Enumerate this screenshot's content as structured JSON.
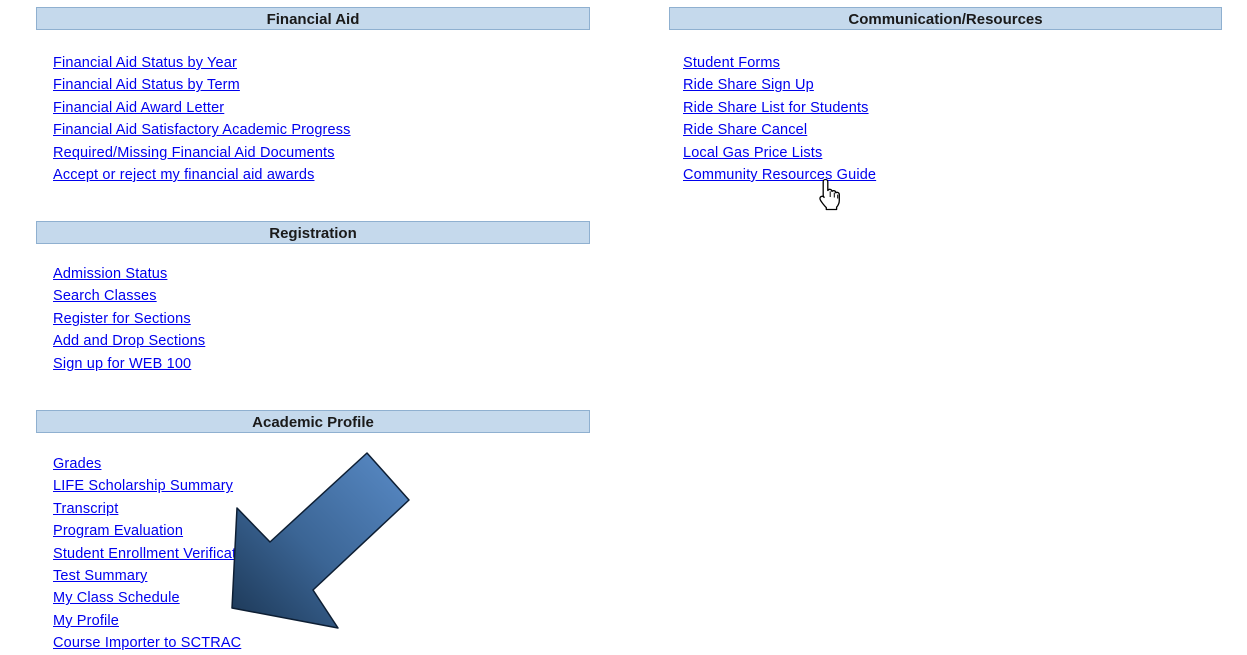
{
  "sections": {
    "financial_aid": {
      "title": "Financial Aid",
      "links": [
        "Financial Aid Status by Year",
        "Financial Aid Status by Term",
        "Financial Aid Award Letter",
        "Financial Aid Satisfactory Academic Progress",
        "Required/Missing Financial Aid Documents",
        "Accept or reject my financial aid awards"
      ]
    },
    "registration": {
      "title": "Registration",
      "links": [
        "Admission Status",
        "Search Classes",
        "Register for Sections",
        "Add and Drop Sections",
        "Sign up for WEB 100"
      ]
    },
    "academic_profile": {
      "title": "Academic Profile",
      "links": [
        "Grades",
        "LIFE Scholarship Summary",
        "Transcript",
        "Program Evaluation",
        "Student Enrollment Verification",
        "Test Summary",
        "My Class Schedule",
        "My Profile",
        "Course Importer to SCTRAC"
      ]
    },
    "communication": {
      "title": "Communication/Resources",
      "links": [
        "Student Forms",
        "Ride Share Sign Up",
        "Ride Share List for Students",
        "Ride Share Cancel",
        "Local Gas Price Lists",
        "Community Resources Guide"
      ]
    }
  },
  "colors": {
    "header_bg": "#c5d9ec",
    "header_border": "#8fb0d0",
    "link": "#0000ee",
    "arrow_light": "#5a8cc8",
    "arrow_dark": "#1b3654"
  },
  "icons": {
    "cursor": "hand-pointer-icon",
    "annotation": "arrow-annotation-icon"
  }
}
